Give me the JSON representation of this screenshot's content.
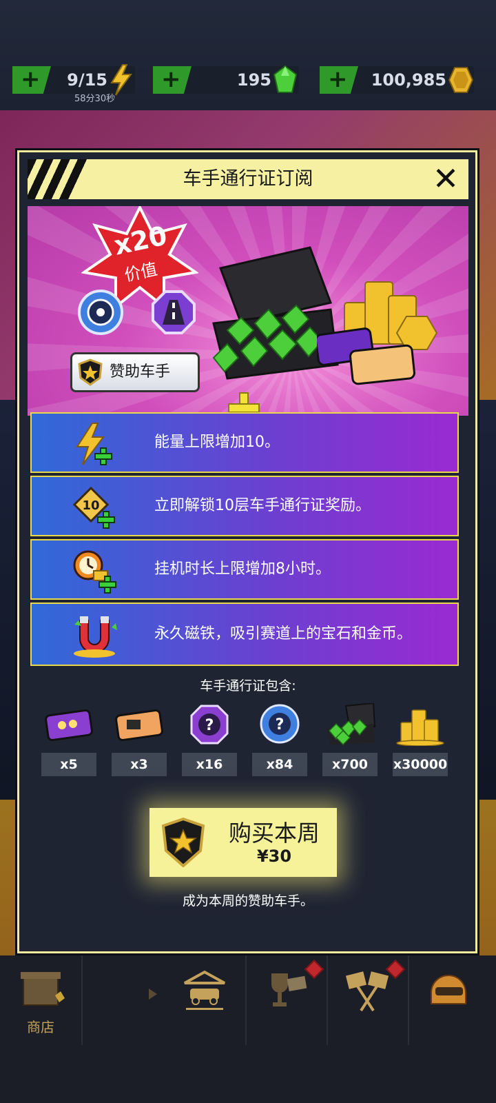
{
  "currency": [
    {
      "value": "9/15",
      "sub": "58分30秒",
      "icon": "lightning-icon"
    },
    {
      "value": "195",
      "icon": "green-gem-icon"
    },
    {
      "value": "100,985",
      "icon": "gold-coin-icon"
    }
  ],
  "modal": {
    "title": "车手通行证订阅",
    "badge_multiplier": "x20",
    "badge_label": "价值",
    "sponsor_label": "赞助车手",
    "features": [
      {
        "icon": "lightning-plus-icon",
        "text": "能量上限增加10。"
      },
      {
        "icon": "unlock-10-tiers-icon",
        "text": "立即解锁10层车手通行证奖励。"
      },
      {
        "icon": "idle-timer-plus-icon",
        "text": "挂机时长上限增加8小时。"
      },
      {
        "icon": "magnet-icon",
        "text": "永久磁铁，吸引赛道上的宝石和金币。"
      }
    ],
    "includes_title": "车手通行证包含:",
    "items": [
      {
        "icon": "turbo-card-icon",
        "qty": "x5"
      },
      {
        "icon": "engine-card-icon",
        "qty": "x3"
      },
      {
        "icon": "mystery-purple-icon",
        "qty": "x16"
      },
      {
        "icon": "mystery-blue-icon",
        "qty": "x84"
      },
      {
        "icon": "gem-chest-icon",
        "qty": "x700"
      },
      {
        "icon": "coin-pile-icon",
        "qty": "x30000"
      }
    ],
    "buy_label": "购买本周",
    "buy_price": "¥30",
    "buy_subtitle": "成为本周的赞助车手。"
  },
  "nav": {
    "shop_label": "商店"
  },
  "colors": {
    "accent_yellow": "#f6f0a2",
    "plus_green": "#2f9a2a",
    "feature_blue": "#2f6ad8",
    "feature_purple": "#9a2ad2"
  }
}
